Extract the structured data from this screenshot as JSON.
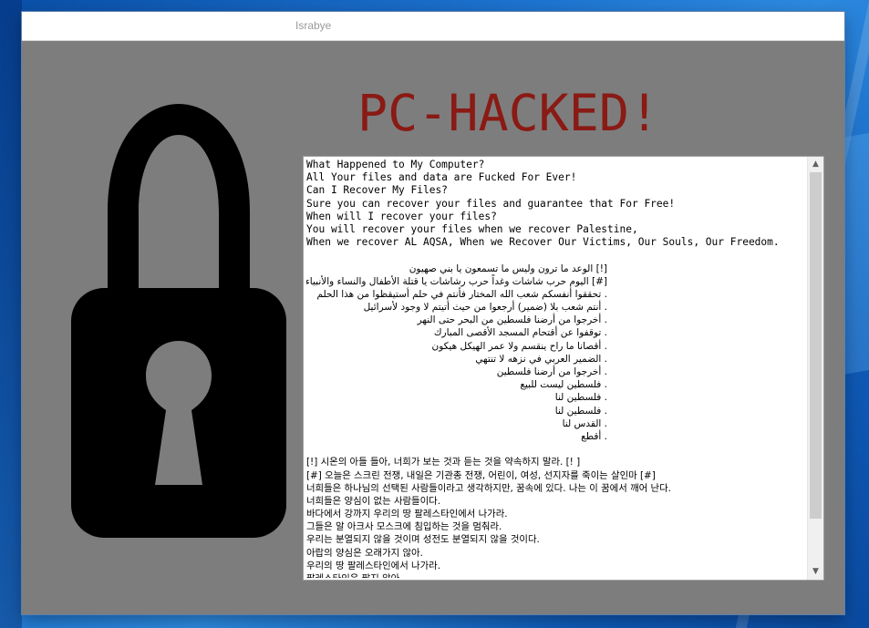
{
  "window": {
    "title": "Israbye"
  },
  "headline": "PC-HACKED!",
  "icons": {
    "lock": "padlock-icon",
    "scroll_up": "chevron-up-icon",
    "scroll_down": "chevron-down-icon"
  },
  "colors": {
    "headline": "#8a1a14",
    "window_bg": "#7d7d7d"
  },
  "ransom_note": {
    "english": [
      "What Happened to My Computer?",
      "All Your files and data are Fucked For Ever!",
      "Can I Recover My Files?",
      "Sure you can recover your files and guarantee that For Free!",
      "When will I recover your files?",
      "You will recover your files when we recover Palestine,",
      "When we recover AL AQSA, When we Recover Our Victims, Our Souls, Our Freedom."
    ],
    "arabic": [
      "[!] الوعد ما ترون وليس ما تسمعون يا بني صهيون",
      "[#] اليوم حرب شاشات وغداً حرب رشاشات يا قتلة الأطفال والنساء والأنبياء",
      ". تحققوا أنفسكم شعب الله المختار فأنتم في حلم أستيقظوا من هذا الحلم",
      ". أنتم شعب بلا (ضمير) أرجعوا من حيث أتيتم لا وجود لأسرائيل",
      ". أخرجوا من أرضنا فلسطين من البحر حتى النهر",
      ". توقفوا عن أقتحام المسجد الأقصى المبارك",
      ". أقصانا ما راح ينقسم ولا عمر الهيكل هيكون",
      ". الضمير العربي في نزهه لا تنتهي",
      ". أخرجوا من أرضنا فلسطين",
      ". فلسطين ليست للبيع",
      ". فلسطين لنا",
      ". فلسطين لنا",
      ". القدس لنا",
      ". أقطع"
    ],
    "korean": [
      "[!] 시온의 아들 들아, 너희가 보는 것과 듣는 것을 약속하지 말라. [! ]",
      "[#] 오늘은 스크린 전쟁, 내일은 기관총 전쟁, 어린이, 여성, 선지자를 죽이는 살인마 [#]",
      "너희들은 하나님의 선택된 사람들이라고 생각하지만, 꿈속에 있다. 나는 이 꿈에서 깨어 난다.",
      "너희들은 양심이 없는 사람들이다.",
      "바다에서 강까지 우리의 땅 팔레스타인에서 나가라.",
      "그들은 알 아크사 모스크에 침입하는 것을 멈춰라.",
      "우리는 분열되지 않을 것이며 성전도 분열되지 않을 것이다.",
      "아랍의 양심은 오래가지 않아.",
      "우리의 땅 팔레스타인에서 나가라.",
      "팔레스타인은 팔지 않아."
    ]
  }
}
